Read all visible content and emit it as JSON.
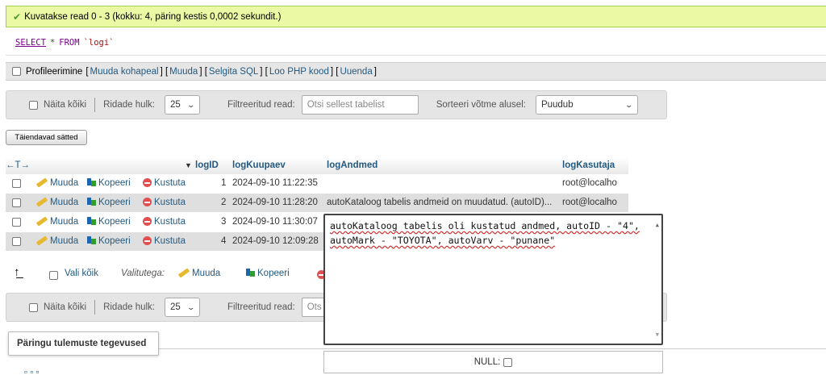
{
  "message": {
    "text": "Kuvatakse read 0 - 3 (kokku: 4, päring kestis 0,0002 sekundit.)"
  },
  "sql": {
    "select": "SELECT",
    "star": "*",
    "from": "FROM",
    "table": "`logi`"
  },
  "profile": {
    "label": "Profileerimine",
    "links": [
      "Muuda kohapeal",
      "Muuda",
      "Selgita SQL",
      "Loo PHP kood",
      "Uuenda"
    ]
  },
  "nav": {
    "show_all": "Näita kõiki",
    "rows_label": "Ridade hulk:",
    "rows_value": "25",
    "filter_label": "Filtreeritud read:",
    "filter_placeholder": "Otsi sellest tabelist",
    "sort_label": "Sorteeri võtme alusel:",
    "sort_value": "Puudub"
  },
  "extra_options": "Täiendavad sätted",
  "table": {
    "arrows": "←T→",
    "sort_indicator": "▼",
    "columns": [
      "logID",
      "logKuupaev",
      "logAndmed",
      "logKasutaja"
    ],
    "actions": {
      "edit": "Muuda",
      "copy": "Kopeeri",
      "delete": "Kustuta"
    },
    "rows": [
      {
        "id": "1",
        "date": "2024-09-10 11:22:35",
        "data": "",
        "user": "root@localho"
      },
      {
        "id": "2",
        "date": "2024-09-10 11:28:20",
        "data": "autoKataloog tabelis andmeid on muudatud. (autoID)...",
        "user": "root@localho"
      },
      {
        "id": "3",
        "date": "2024-09-10 11:30:07",
        "data": "",
        "user": ""
      },
      {
        "id": "4",
        "date": "2024-09-10 12:09:28",
        "data": "",
        "user": ""
      }
    ]
  },
  "bottom": {
    "select_all": "Vali kõik",
    "with_selected": "Valitutega:",
    "edit": "Muuda",
    "copy": "Kopeeri"
  },
  "nav2": {
    "show_all": "Näita kõiki",
    "rows_label": "Ridade hulk:",
    "rows_value": "25",
    "filter_label": "Filtreeritud read:",
    "filter_partial": "Ots"
  },
  "query_ops": "Päringu tulemuste tegevused",
  "editor": {
    "text": "autoKataloog tabelis oli kustatud andmed, autoID - \"4\", autoMark - \"TOYOTA\", autoVarv - \"punane\"",
    "null_label": "NULL:"
  }
}
